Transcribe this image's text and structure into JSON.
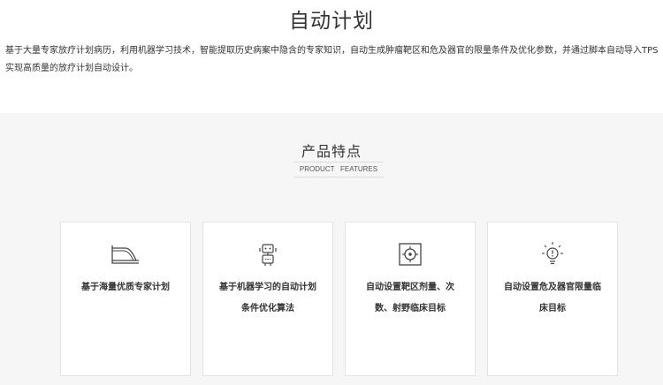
{
  "page": {
    "title": "自动计划",
    "intro_lines": [
      "基于大量专家放疗计划病历，利用机器学习技术，智能提取历史病案中隐含的专家知识，自动生成肿瘤靶区和危及器官的限量条件及优化参数，并通过脚本自动导入TPS",
      "实现高质量的放疗计划自动设计。"
    ]
  },
  "features": {
    "title": "产品特点",
    "subtitle": "PRODUCT   FEATURES",
    "cards": [
      {
        "icon": "curve-chart-icon",
        "label": "基于海量优质专家计划"
      },
      {
        "icon": "robot-icon",
        "label": "基于机器学习的自动计划条件优化算法"
      },
      {
        "icon": "target-icon",
        "label": "自动设置靶区剂量、次数、射野临床目标"
      },
      {
        "icon": "lightbulb-warning-icon",
        "label": "自动设置危及器官限量临床目标"
      }
    ]
  },
  "colors": {
    "text": "#333333",
    "section_bg": "#f6f6f6",
    "card_border": "#e3e3e3"
  }
}
